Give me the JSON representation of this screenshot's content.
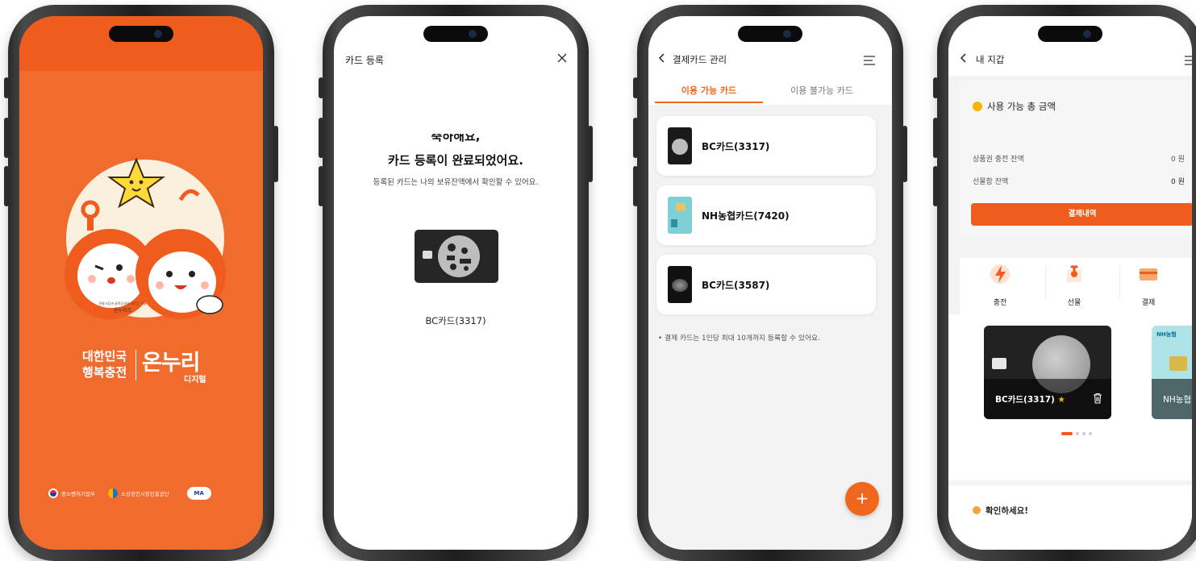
{
  "phone1": {
    "logo_line1": "대한민국",
    "logo_line2": "행복충전",
    "logo_brand": "온누리",
    "logo_brand_sub": "디지털",
    "mascot_caption1": "전통시장과 골목상권의 새로운 이름",
    "mascot_caption2": "온누리즈",
    "org1": "중소벤처기업부",
    "org2": "소상공인시장진흥공단",
    "org3_badge": "MA",
    "colors": {
      "primary": "#ef6c2e",
      "top": "#f05c1e",
      "circle": "#fbf0dd"
    }
  },
  "phone2": {
    "title": "카드 등록",
    "close_icon": "close-icon",
    "heading_line1": "축하해요,",
    "heading_line2": "카드 등록이 완료되었어요.",
    "description": "등록된 카드는 나의 보유잔액에서 확인할 수 있어요.",
    "card_name": "BC카드(3317)"
  },
  "phone3": {
    "title": "결제카드 관리",
    "tabs": [
      {
        "label": "이용 가능 카드",
        "active": true
      },
      {
        "label": "이용 불가능 카드",
        "active": false
      }
    ],
    "cards": [
      {
        "name": "BC카드(3317)",
        "color": "#1a1a1a"
      },
      {
        "name": "NH농협카드(7420)",
        "color": "#7fd0d6"
      },
      {
        "name": "BC카드(3587)",
        "color": "#111111"
      }
    ],
    "notice": "결제 카드는 1인당 최대 10개까지 등록할 수 있어요.",
    "fab": "+",
    "accent": "#f0661d"
  },
  "phone4": {
    "title": "내 지갑",
    "balance_label": "사용 가능 총 금액",
    "rows": [
      {
        "label": "상품권 충전 잔액",
        "value": "0 원"
      },
      {
        "label": "선물함 잔액",
        "value": "0 원"
      }
    ],
    "history_button": "결제내역",
    "actions": [
      {
        "label": "충전",
        "icon": "lightning-icon"
      },
      {
        "label": "선물",
        "icon": "gift-icon"
      },
      {
        "label": "결제",
        "icon": "card-icon"
      }
    ],
    "main_card": "BC카드(3317)",
    "second_card": "NH농협",
    "second_card_brand": "NH농협",
    "notice": "확인하세요!"
  }
}
